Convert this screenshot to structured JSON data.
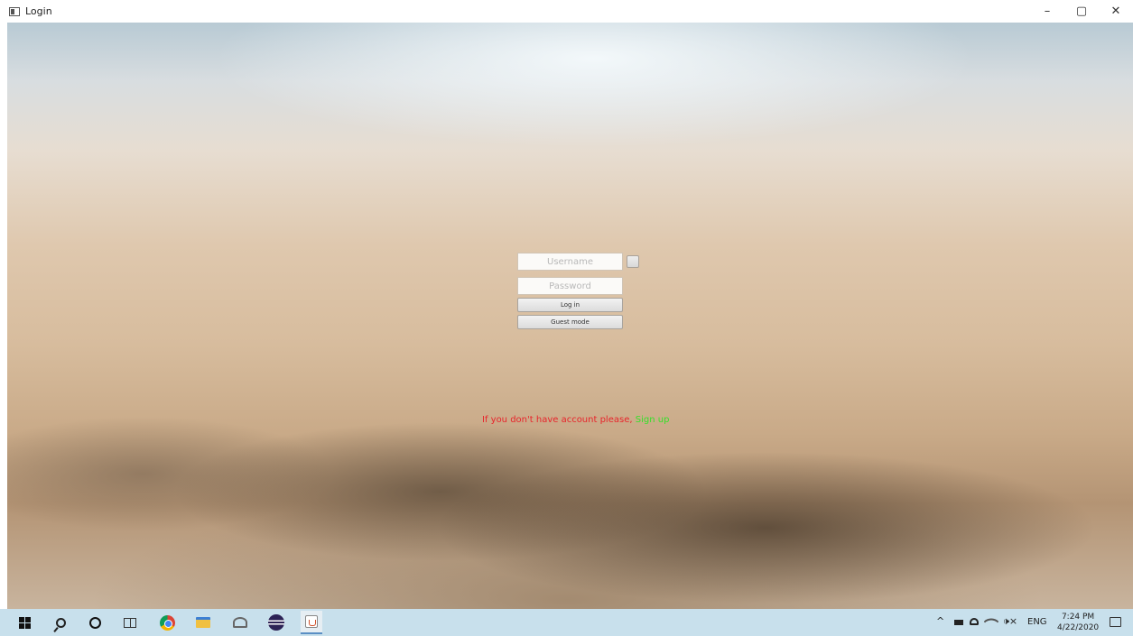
{
  "window": {
    "title": "Login",
    "minimize_glyph": "–",
    "maximize_glyph": "▢",
    "close_glyph": "✕"
  },
  "login": {
    "username_placeholder": "Username",
    "password_placeholder": "Password",
    "login_label": "Log in",
    "guest_label": "Guest mode"
  },
  "signup": {
    "prompt": "If you don't have account please,",
    "link": "Sign up",
    "prompt_color": "#e8242b",
    "link_color": "#36e02a"
  },
  "taskbar": {
    "apps": [
      "windows-start-icon",
      "search-icon",
      "cortana-icon",
      "task-view-icon",
      "chrome-icon",
      "file-explorer-icon",
      "snail-app-icon",
      "eclipse-icon",
      "java-app-icon"
    ],
    "tray": {
      "caret": "^",
      "volume": "🕩×",
      "language": "ENG",
      "time": "7:24 PM",
      "date": "4/22/2020"
    }
  },
  "colors": {
    "taskbar_bg": "#c8e0ec",
    "accent": "#5a8fc4"
  }
}
